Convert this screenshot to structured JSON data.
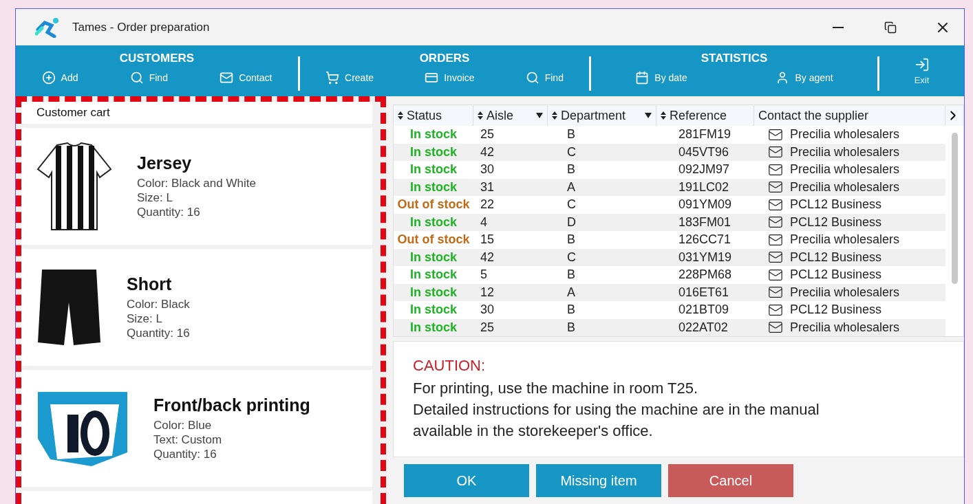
{
  "window": {
    "title": "Tames - Order preparation"
  },
  "toolbar": [
    {
      "title": "CUSTOMERS",
      "items": [
        {
          "label": "Add"
        },
        {
          "label": "Find"
        },
        {
          "label": "Contact"
        }
      ]
    },
    {
      "title": "ORDERS",
      "items": [
        {
          "label": "Create"
        },
        {
          "label": "Invoice"
        },
        {
          "label": "Find"
        }
      ]
    },
    {
      "title": "STATISTICS",
      "items": [
        {
          "label": "By date"
        },
        {
          "label": "By agent"
        }
      ]
    }
  ],
  "exit": {
    "label": "Exit"
  },
  "cart": {
    "title": "Customer cart",
    "items": [
      {
        "name": "Jersey",
        "kind": "jersey",
        "details": [
          "Color: Black and White",
          "Size: L",
          "Quantity: 16"
        ]
      },
      {
        "name": "Short",
        "kind": "short",
        "details": [
          "Color: Black",
          "Size: L",
          "Quantity: 16"
        ]
      },
      {
        "name": "Front/back printing",
        "kind": "printing",
        "details": [
          "Color: Blue",
          "Text: Custom",
          "Quantity: 16"
        ]
      }
    ]
  },
  "table": {
    "columns": [
      {
        "label": "Status",
        "sortable": true,
        "filter": false
      },
      {
        "label": "Aisle",
        "sortable": true,
        "filter": true
      },
      {
        "label": "Department",
        "sortable": true,
        "filter": true
      },
      {
        "label": "Reference",
        "sortable": true,
        "filter": false
      },
      {
        "label": "Contact the supplier",
        "sortable": false,
        "filter": false
      }
    ],
    "rows": [
      {
        "status": "In stock",
        "kind": "in",
        "aisle": "25",
        "department": "B",
        "reference": "281FM19",
        "supplier": "Precilia wholesalers"
      },
      {
        "status": "In stock",
        "kind": "in",
        "aisle": "42",
        "department": "C",
        "reference": "045VT96",
        "supplier": "Precilia wholesalers"
      },
      {
        "status": "In stock",
        "kind": "in",
        "aisle": "30",
        "department": "B",
        "reference": "092JM97",
        "supplier": "Precilia wholesalers"
      },
      {
        "status": "In stock",
        "kind": "in",
        "aisle": "31",
        "department": "A",
        "reference": "191LC02",
        "supplier": "Precilia wholesalers"
      },
      {
        "status": "Out of stock",
        "kind": "out",
        "aisle": "22",
        "department": "C",
        "reference": "091YM09",
        "supplier": "PCL12 Business"
      },
      {
        "status": "In stock",
        "kind": "in",
        "aisle": "4",
        "department": "D",
        "reference": "183FM01",
        "supplier": "PCL12 Business"
      },
      {
        "status": "Out of stock",
        "kind": "out",
        "aisle": "15",
        "department": "B",
        "reference": "126CC71",
        "supplier": "Precilia wholesalers"
      },
      {
        "status": "In stock",
        "kind": "in",
        "aisle": "42",
        "department": "C",
        "reference": "031YM19",
        "supplier": "PCL12 Business"
      },
      {
        "status": "In stock",
        "kind": "in",
        "aisle": "5",
        "department": "B",
        "reference": "228PM68",
        "supplier": "PCL12 Business"
      },
      {
        "status": "In stock",
        "kind": "in",
        "aisle": "12",
        "department": "A",
        "reference": "016ET61",
        "supplier": "Precilia wholesalers"
      },
      {
        "status": "In stock",
        "kind": "in",
        "aisle": "30",
        "department": "B",
        "reference": "021BT09",
        "supplier": "PCL12 Business"
      },
      {
        "status": "In stock",
        "kind": "in",
        "aisle": "25",
        "department": "B",
        "reference": "022AT02",
        "supplier": "Precilia wholesalers"
      }
    ]
  },
  "notice": {
    "title": "CAUTION:",
    "lines": [
      "For printing, use the machine in room T25.",
      "Detailed instructions for using the machine are in the manual",
      "available in the storekeeper's office."
    ]
  },
  "buttons": [
    {
      "label": "OK",
      "kind": "primary"
    },
    {
      "label": "Missing item",
      "kind": "primary"
    },
    {
      "label": "Cancel",
      "kind": "danger"
    }
  ]
}
